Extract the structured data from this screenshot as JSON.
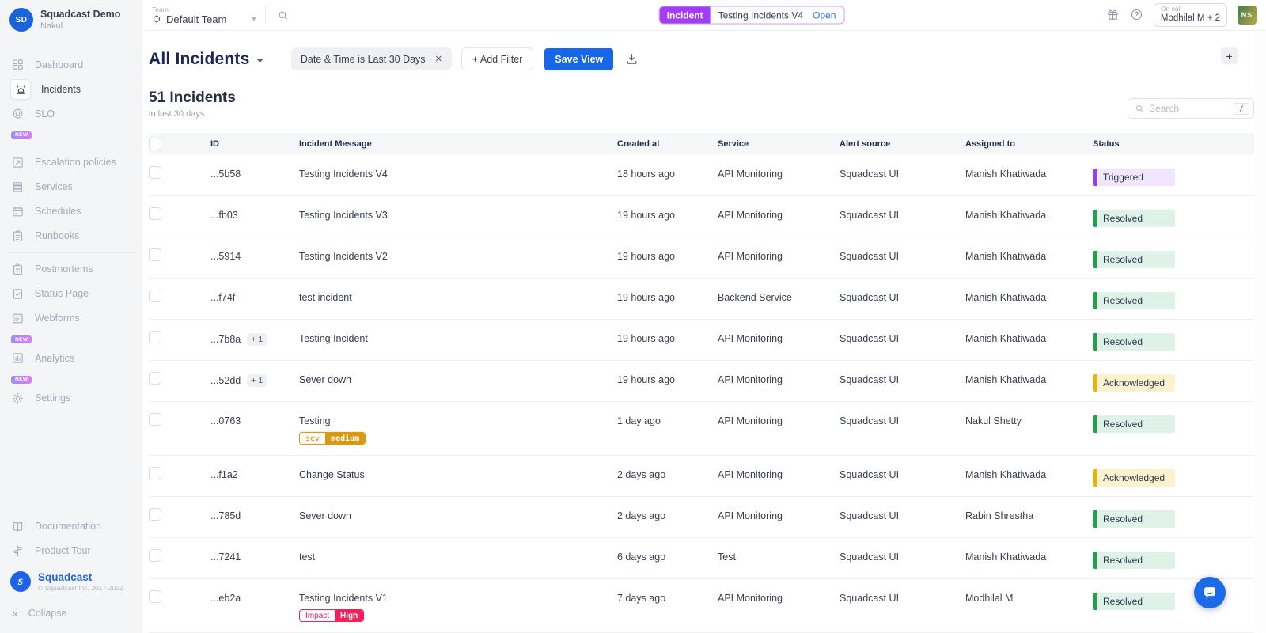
{
  "brand": {
    "initials": "SD",
    "org": "Squadcast Demo",
    "user": "Nakul"
  },
  "sidebar": {
    "nav": [
      {
        "label": "Dashboard",
        "icon": "dashboard-icon"
      },
      {
        "label": "Incidents",
        "icon": "incidents-icon",
        "active": true
      },
      {
        "label": "SLO",
        "icon": "slo-icon",
        "badge": "NEW",
        "divider_after": true
      },
      {
        "label": "Escalation policies",
        "icon": "escalation-policies-icon"
      },
      {
        "label": "Services",
        "icon": "services-icon"
      },
      {
        "label": "Schedules",
        "icon": "schedules-icon"
      },
      {
        "label": "Runbooks",
        "icon": "runbooks-icon",
        "divider_after": true
      },
      {
        "label": "Postmortems",
        "icon": "postmortems-icon"
      },
      {
        "label": "Status Page",
        "icon": "status-page-icon"
      },
      {
        "label": "Webforms",
        "icon": "webforms-icon",
        "badge": "NEW"
      },
      {
        "label": "Analytics",
        "icon": "analytics-icon",
        "badge": "NEW"
      },
      {
        "label": "Settings",
        "icon": "settings-icon"
      }
    ],
    "footer_nav": [
      {
        "label": "Documentation",
        "icon": "documentation-icon"
      },
      {
        "label": "Product Tour",
        "icon": "product-tour-icon"
      }
    ],
    "brand_footer": {
      "name": "Squadcast",
      "copyright": "© Squadcast Inc. 2017-2022"
    },
    "collapse_label": "Collapse"
  },
  "topbar": {
    "team_label": "Team",
    "team_value": "Default Team",
    "incident_pill": {
      "badge": "Incident",
      "title": "Testing Incidents V4",
      "action": "Open"
    },
    "oncall": {
      "label": "On call",
      "value": "Modhilal M + 2"
    },
    "avatar_initials": "NS"
  },
  "toolbar": {
    "view_title": "All Incidents",
    "filter_chip": "Date & Time is Last 30 Days",
    "add_filter_label": "+ Add Filter",
    "save_view_label": "Save View",
    "add_button_label": "+"
  },
  "summary": {
    "count_title": "51 Incidents",
    "subtitle": "in last 30 days"
  },
  "search": {
    "placeholder": "Search",
    "shortcut": "/"
  },
  "table": {
    "headers": [
      "ID",
      "Incident Message",
      "Created at",
      "Service",
      "Alert source",
      "Assigned to",
      "Status"
    ],
    "rows": [
      {
        "id": "...5b58",
        "message": "Testing Incidents V4",
        "created": "18 hours ago",
        "service": "API Monitoring",
        "source": "Squadcast UI",
        "assigned": "Manish Khatiwada",
        "status": {
          "label": "Triggered",
          "theme": "triggered"
        }
      },
      {
        "id": "...fb03",
        "message": "Testing Incidents V3",
        "created": "19 hours ago",
        "service": "API Monitoring",
        "source": "Squadcast UI",
        "assigned": "Manish Khatiwada",
        "status": {
          "label": "Resolved",
          "theme": "resolved"
        }
      },
      {
        "id": "...5914",
        "message": "Testing Incidents V2",
        "created": "19 hours ago",
        "service": "API Monitoring",
        "source": "Squadcast UI",
        "assigned": "Manish Khatiwada",
        "status": {
          "label": "Resolved",
          "theme": "resolved"
        }
      },
      {
        "id": "...f74f",
        "message": "test incident",
        "created": "19 hours ago",
        "service": "Backend Service",
        "source": "Squadcast UI",
        "assigned": "Manish Khatiwada",
        "status": {
          "label": "Resolved",
          "theme": "resolved"
        }
      },
      {
        "id": "...7b8a",
        "extra": "+ 1",
        "message": "Testing Incident",
        "created": "19 hours ago",
        "service": "API Monitoring",
        "source": "Squadcast UI",
        "assigned": "Manish Khatiwada",
        "status": {
          "label": "Resolved",
          "theme": "resolved"
        }
      },
      {
        "id": "...52dd",
        "extra": "+ 1",
        "message": "Sever down",
        "created": "19 hours ago",
        "service": "API Monitoring",
        "source": "Squadcast UI",
        "assigned": "Manish Khatiwada",
        "status": {
          "label": "Acknowledged",
          "theme": "acknowledged"
        }
      },
      {
        "id": "...0763",
        "message": "Testing",
        "tag": {
          "key": "sev",
          "value": "medium",
          "theme": "amber",
          "mono": true
        },
        "created": "1 day ago",
        "service": "API Monitoring",
        "source": "Squadcast UI",
        "assigned": "Nakul Shetty",
        "status": {
          "label": "Resolved",
          "theme": "resolved"
        }
      },
      {
        "id": "...f1a2",
        "message": "Change Status",
        "created": "2 days ago",
        "service": "API Monitoring",
        "source": "Squadcast UI",
        "assigned": "Manish Khatiwada",
        "status": {
          "label": "Acknowledged",
          "theme": "acknowledged"
        }
      },
      {
        "id": "...785d",
        "message": "Sever down",
        "created": "2 days ago",
        "service": "API Monitoring",
        "source": "Squadcast UI",
        "assigned": "Rabin Shrestha",
        "status": {
          "label": "Resolved",
          "theme": "resolved"
        }
      },
      {
        "id": "...7241",
        "message": "test",
        "created": "6 days ago",
        "service": "Test",
        "source": "Squadcast UI",
        "assigned": "Manish Khatiwada",
        "status": {
          "label": "Resolved",
          "theme": "resolved"
        }
      },
      {
        "id": "...eb2a",
        "message": "Testing Incidents V1",
        "tag": {
          "key": "Impact",
          "value": "High",
          "theme": "red",
          "mono": false
        },
        "created": "7 days ago",
        "service": "API Monitoring",
        "source": "Squadcast UI",
        "assigned": "Modhilal M",
        "status": {
          "label": "Resolved",
          "theme": "resolved"
        }
      }
    ]
  },
  "colors": {
    "accent_blue": "#1766e8",
    "incident_purple": "#a33df2",
    "triggered_bar": "#9c3cf0",
    "triggered_bg": "#f1e6fd",
    "resolved_bar": "#21a14a",
    "resolved_bg": "#def2e7",
    "acknowledged_bar": "#e9b10a",
    "acknowledged_bg": "#fcf3ce",
    "tag_amber": "#d79a12",
    "tag_red": "#f52057",
    "sidebar_bg": "#f4f5f7"
  }
}
